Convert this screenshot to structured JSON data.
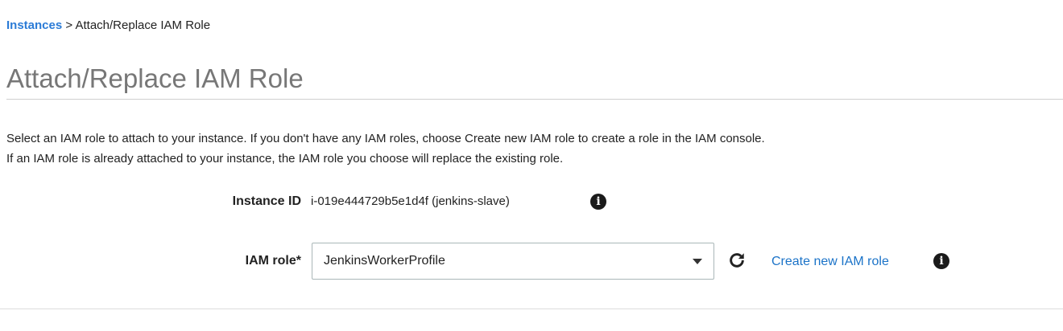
{
  "breadcrumb": {
    "link_label": "Instances",
    "separator": " > ",
    "current": "Attach/Replace IAM Role"
  },
  "page": {
    "title": "Attach/Replace IAM Role",
    "description": [
      "Select an IAM role to attach to your instance. If you don't have any IAM roles, choose Create new IAM role to create a role in the IAM console.",
      "If an IAM role is already attached to your instance, the IAM role you choose will replace the existing role."
    ]
  },
  "form": {
    "instance_id": {
      "label": "Instance ID",
      "value": "i-019e444729b5e1d4f (jenkins-slave)",
      "icon": "info-icon"
    },
    "iam_role": {
      "label": "IAM role*",
      "selected": "JenkinsWorkerProfile",
      "refresh_icon": "refresh-icon",
      "create_link": "Create new IAM role",
      "icon": "info-icon"
    }
  },
  "colors": {
    "link": "#1b73c8",
    "breadcrumb_link": "#2b7bd6",
    "title": "#777777"
  }
}
